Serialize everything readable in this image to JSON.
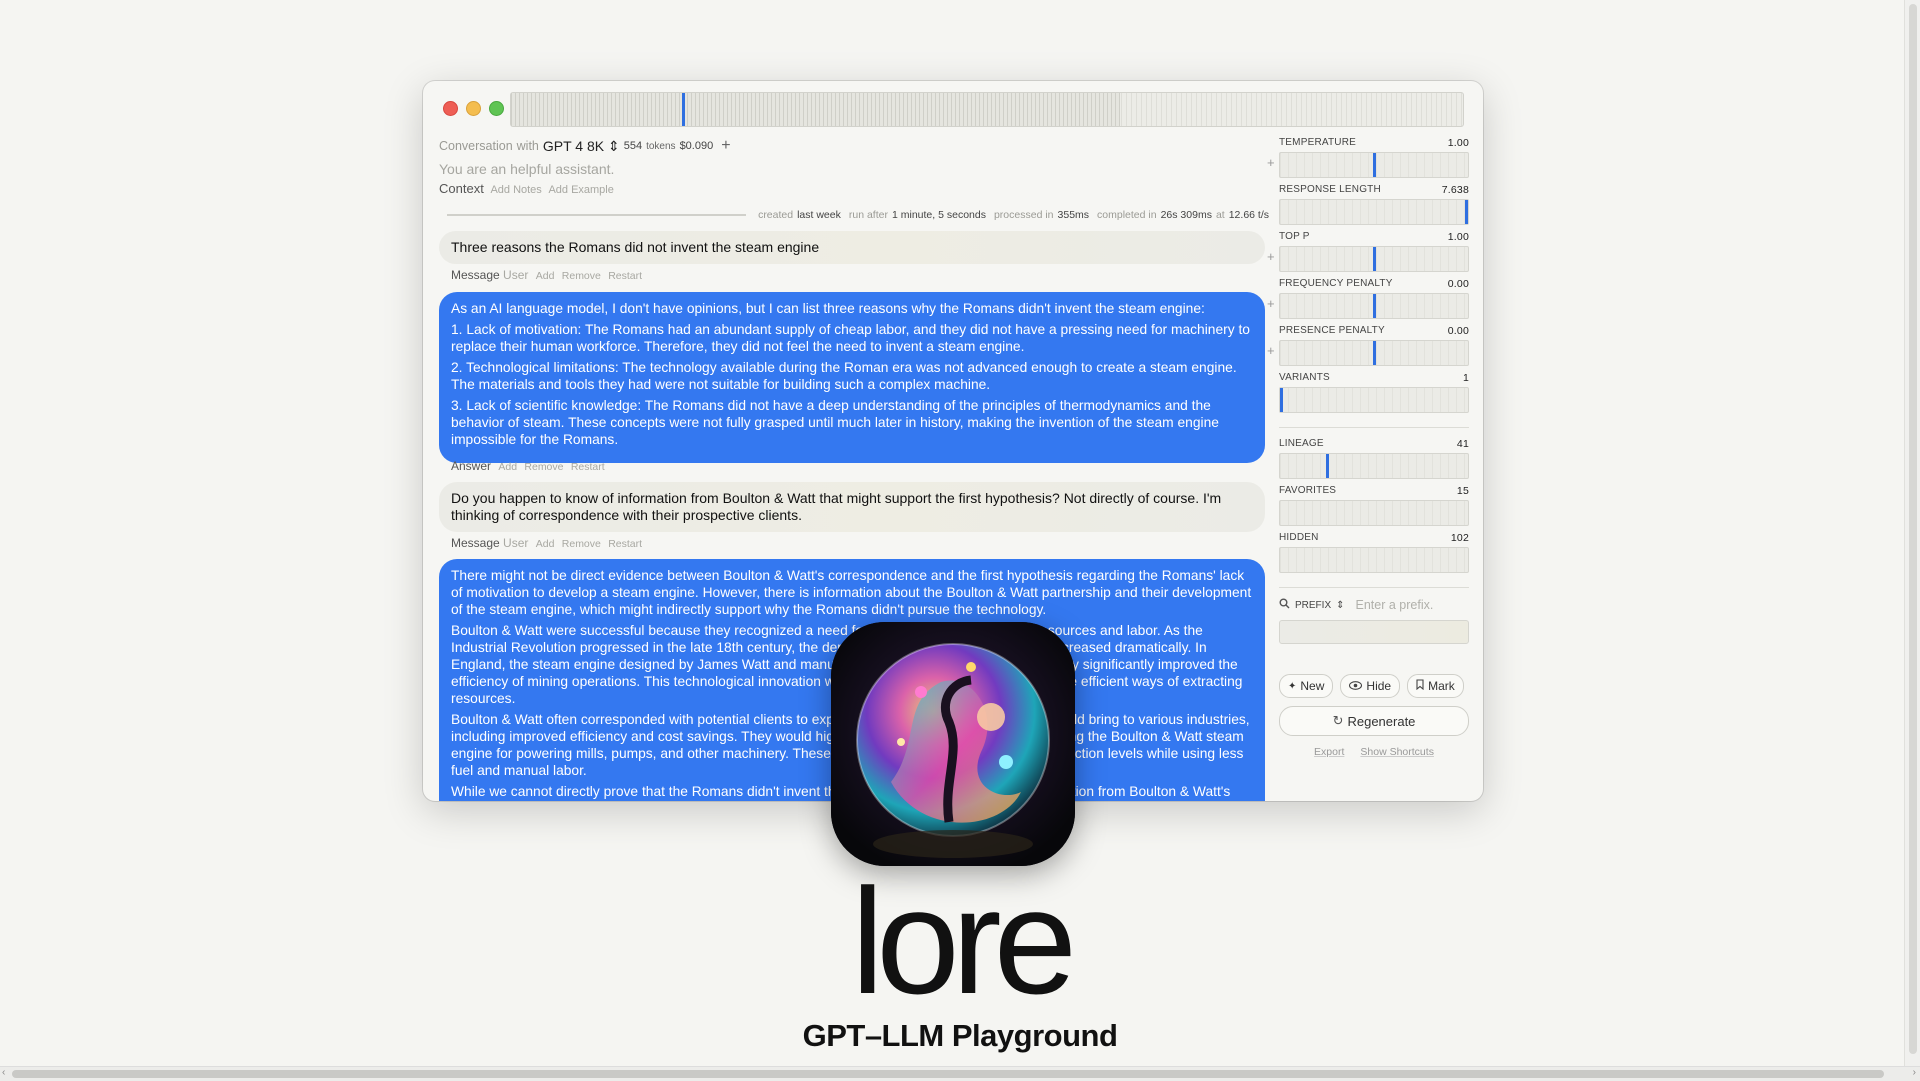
{
  "conversation": {
    "header_label": "Conversation",
    "with_label": "with",
    "model": "GPT 4 8K",
    "tokens": "554",
    "tokens_label": "tokens",
    "cost": "$0.090",
    "add_label": "+",
    "system_prompt": "You are an helpful assistant.",
    "context_label": "Context",
    "add_notes": "Add Notes",
    "add_example": "Add Example"
  },
  "stats": {
    "created_label": "created",
    "created_value": "last week",
    "run_label": "run after",
    "run_value": "1 minute, 5 seconds",
    "processed_label": "processed in",
    "processed_value": "355ms",
    "completed_label": "completed in",
    "completed_value": "26s 309ms",
    "at_label": "at",
    "rate_value": "12.66 t/s"
  },
  "messages": [
    {
      "kind": "user",
      "text": "Three reasons the Romans did not invent the steam engine",
      "meta_label": "Message",
      "role": "User",
      "actions": [
        "Add",
        "Remove",
        "Restart"
      ]
    },
    {
      "kind": "answer",
      "paragraphs": [
        "As an AI language model, I don't have opinions, but I can list three reasons why the Romans didn't invent the steam engine:",
        "1. Lack of motivation: The Romans had an abundant supply of cheap labor, and they did not have a pressing need for machinery to replace their human workforce. Therefore, they did not feel the need to invent a steam engine.",
        "2. Technological limitations: The technology available during the Roman era was not advanced enough to create a steam engine. The materials and tools they had were not suitable for building such a complex machine.",
        "3. Lack of scientific knowledge: The Romans did not have a deep understanding of the principles of thermodynamics and the behavior of steam. These concepts were not fully grasped until much later in history, making the invention of the steam engine impossible for the Romans."
      ],
      "meta_label": "Answer",
      "actions": [
        "Add",
        "Remove",
        "Restart"
      ]
    },
    {
      "kind": "user",
      "text": "Do you happen to know of information from Boulton & Watt that might support the first hypothesis? Not directly of course. I'm thinking of correspondence with their prospective clients.",
      "meta_label": "Message",
      "role": "User",
      "actions": [
        "Add",
        "Remove",
        "Restart"
      ]
    },
    {
      "kind": "answer",
      "paragraphs": [
        "There might not be direct evidence between Boulton & Watt's correspondence and the first hypothesis regarding the Romans' lack of motivation to develop a steam engine. However, there is information about the Boulton & Watt partnership and their development of the steam engine, which might indirectly support why the Romans didn't pursue the technology.",
        "Boulton & Watt were successful because they recognized a need for machinery that could save resources and labor. As the Industrial Revolution progressed in the late 18th century, the demand for coal and other resources increased dramatically. In England, the steam engine designed by James Watt and manufactured by Matthew Boulton's company significantly improved the efficiency of mining operations. This technological innovation was driven by the practical need for more efficient ways of extracting resources.",
        "Boulton & Watt often corresponded with potential clients to explain the benefits their steam engine could bring to various industries, including improved efficiency and cost savings. They would highlight the competitive advantage of using the Boulton & Watt steam engine for powering mills, pumps, and other machinery. These industries, in turn, saw increased production levels while using less fuel and manual labor.",
        "While we cannot directly prove that the Romans didn't invent the steam engine due to a lack of motivation from Boulton & Watt's correspondence..."
      ]
    }
  ],
  "params": [
    {
      "label": "TEMPERATURE",
      "value": "1.00",
      "level": 0.5,
      "plus": true
    },
    {
      "label": "RESPONSE LENGTH",
      "value": "7.638",
      "level": 1.0,
      "plus": false
    },
    {
      "label": "TOP P",
      "value": "1.00",
      "level": 0.5,
      "plus": true
    },
    {
      "label": "FREQUENCY PENALTY",
      "value": "0.00",
      "level": 0.5,
      "plus": true
    },
    {
      "label": "PRESENCE PENALTY",
      "value": "0.00",
      "level": 0.5,
      "plus": true
    },
    {
      "label": "VARIANTS",
      "value": "1",
      "level": 0.0,
      "plus": false
    }
  ],
  "counters": [
    {
      "label": "LINEAGE",
      "value": "41",
      "level": 0.25
    },
    {
      "label": "FAVORITES",
      "value": "15",
      "level": null
    },
    {
      "label": "HIDDEN",
      "value": "102",
      "level": null
    }
  ],
  "timeline": {
    "marker": 0.18,
    "filled": 0.64
  },
  "prefix": {
    "label": "PREFIX",
    "placeholder": "Enter a prefix."
  },
  "buttons": {
    "new": "New",
    "hide": "Hide",
    "mark": "Mark",
    "regenerate": "Regenerate"
  },
  "footer": {
    "export": "Export",
    "shortcuts": "Show Shortcuts"
  },
  "branding": {
    "name": "lore",
    "tagline": "GPT–LLM Playground"
  },
  "colors": {
    "accent": "#3478f0",
    "answer_bubble": "#3478f0",
    "user_bubble": "#ebebe6"
  }
}
